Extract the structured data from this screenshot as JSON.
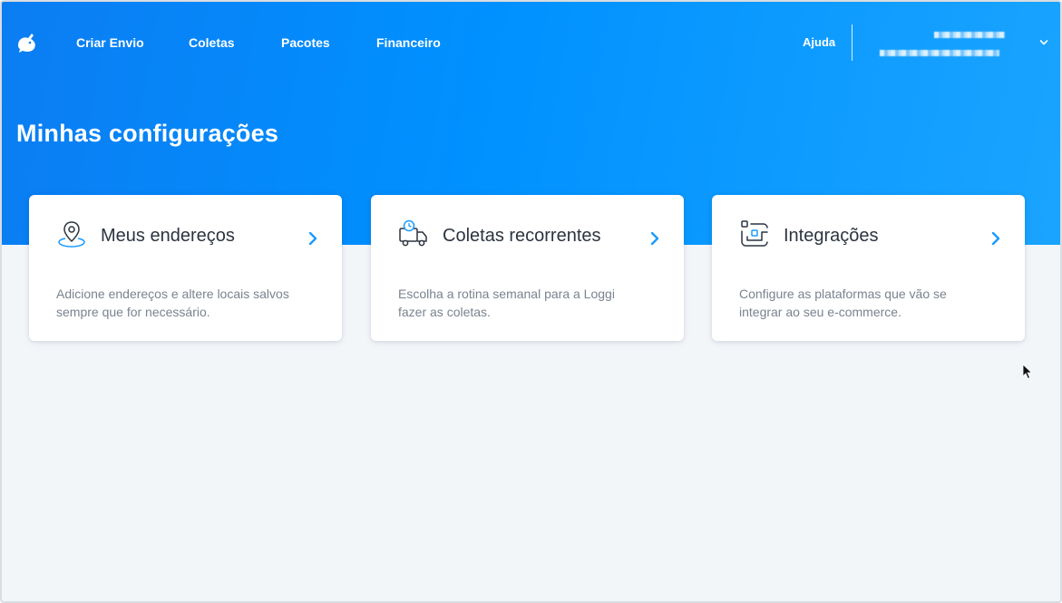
{
  "nav": {
    "items": [
      {
        "label": "Criar Envio"
      },
      {
        "label": "Coletas"
      },
      {
        "label": "Pacotes"
      },
      {
        "label": "Financeiro"
      }
    ],
    "help_label": "Ajuda",
    "logo_icon": "loggi-logo-icon",
    "account_chevron_icon": "chevron-down-icon"
  },
  "page": {
    "title": "Minhas configurações"
  },
  "cards": [
    {
      "title": "Meus endereços",
      "description": "Adicione endereços e altere locais salvos sempre que for necessário.",
      "icon": "location-pin-icon",
      "arrow_icon": "chevron-right-icon"
    },
    {
      "title": "Coletas recorrentes",
      "description": "Escolha a rotina semanal para a Loggi fazer as coletas.",
      "icon": "delivery-truck-clock-icon",
      "arrow_icon": "chevron-right-icon"
    },
    {
      "title": "Integrações",
      "description": "Configure as plataformas que vão se integrar ao seu e-commerce.",
      "icon": "integrations-icon",
      "arrow_icon": "chevron-right-icon"
    }
  ],
  "colors": {
    "brand_blue": "#0091ff",
    "accent_arrow": "#1a9bff",
    "background": "#f3f6f9",
    "card_text": "#2c3440",
    "muted_text": "#7a8390"
  }
}
